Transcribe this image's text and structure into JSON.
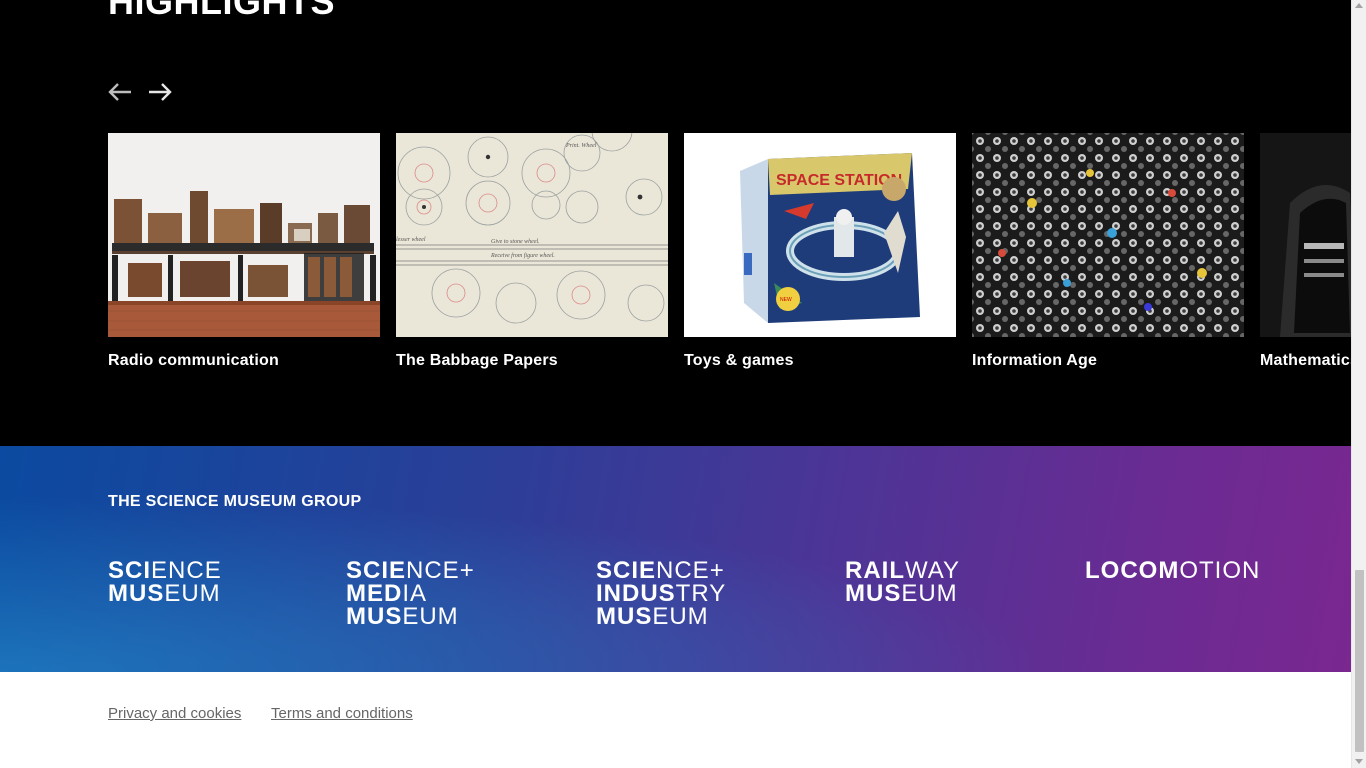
{
  "highlights": {
    "title": "HIGHLIGHTS",
    "prev_icon": "arrow-left-icon",
    "next_icon": "arrow-right-icon",
    "cards": [
      {
        "label": "Radio communication",
        "icon": "radio-equipment-image"
      },
      {
        "label": "The Babbage Papers",
        "icon": "babbage-drawing-image"
      },
      {
        "label": "Toys & games",
        "icon": "space-station-toy-image"
      },
      {
        "label": "Information Age",
        "icon": "switchboard-plugs-image"
      },
      {
        "label": "Mathematics",
        "icon": "calculating-machine-image"
      }
    ]
  },
  "group": {
    "title": "THE SCIENCE MUSEUM GROUP",
    "logos": [
      {
        "name": "science-museum",
        "lines": [
          [
            "SCI",
            "ENCE"
          ],
          [
            "MUS",
            "EUM"
          ]
        ]
      },
      {
        "name": "science-media-museum",
        "lines": [
          [
            "SCIE",
            "NCE+"
          ],
          [
            "MED",
            "IA"
          ],
          [
            "MUS",
            "EUM"
          ]
        ]
      },
      {
        "name": "science-industry-museum",
        "lines": [
          [
            "SCIE",
            "NCE+"
          ],
          [
            "INDUS",
            "TRY"
          ],
          [
            "MUS",
            "EUM"
          ]
        ]
      },
      {
        "name": "railway-museum",
        "lines": [
          [
            "RAIL",
            "WAY"
          ],
          [
            "MUS",
            "EUM"
          ]
        ]
      },
      {
        "name": "locomotion",
        "lines": [
          [
            "LOCOM",
            "OTION"
          ]
        ]
      }
    ]
  },
  "footer": {
    "privacy_label": "Privacy and cookies",
    "terms_label": "Terms and conditions"
  },
  "colors": {
    "highlights_bg": "#000000",
    "group_gradient_start": "#0b4aa0",
    "group_gradient_end": "#7a2790",
    "footer_link": "#666666"
  }
}
